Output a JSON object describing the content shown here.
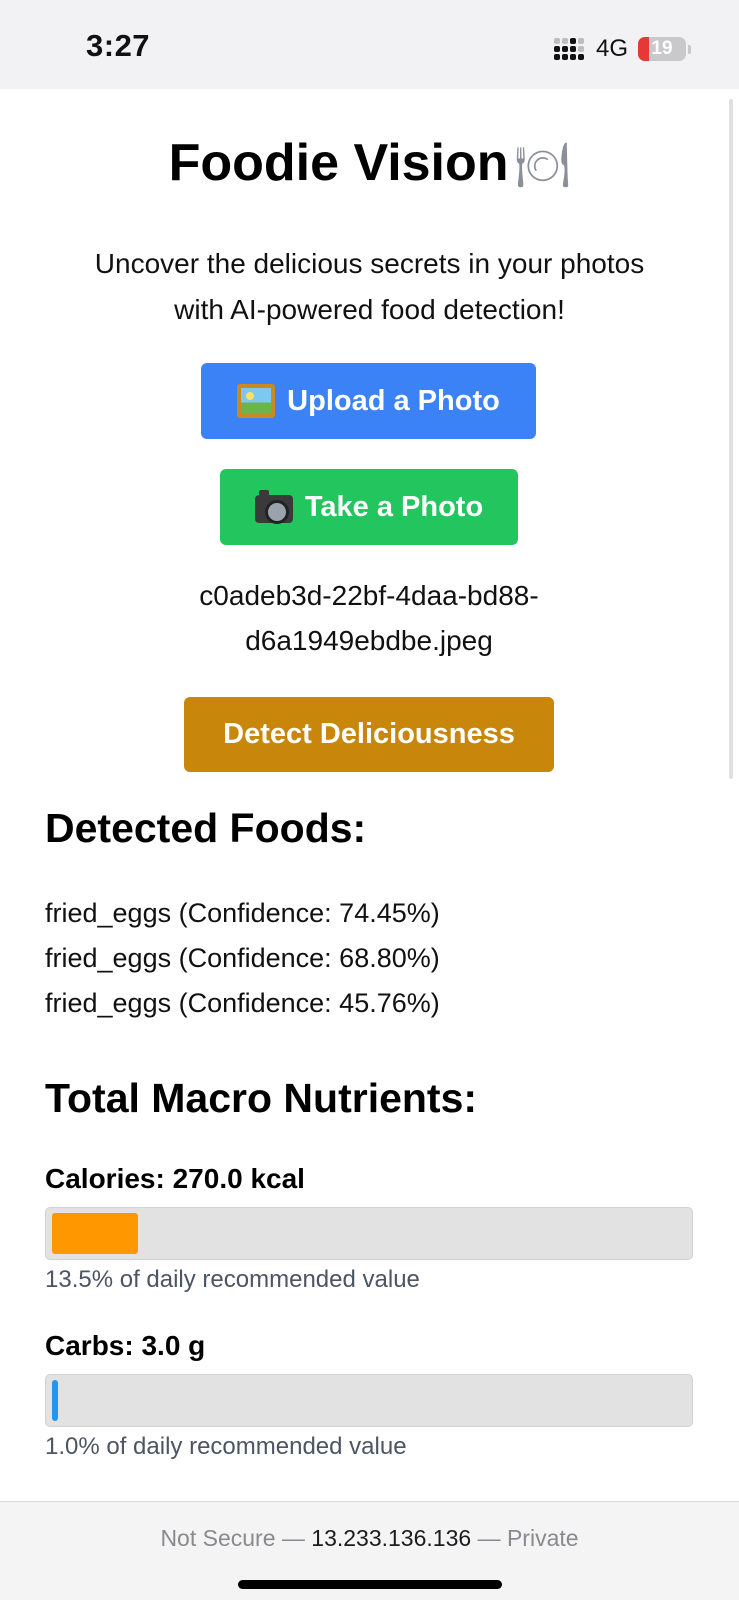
{
  "status_bar": {
    "time": "3:27",
    "network": "4G",
    "battery_level": "19",
    "battery_color": "#e53935"
  },
  "header": {
    "title": "Foodie Vision",
    "title_icon": "fork-and-knife-with-plate-icon",
    "subtitle_line1": "Uncover the delicious secrets in your photos",
    "subtitle_line2": "with AI-powered food detection!"
  },
  "actions": {
    "upload_label": "Upload a Photo",
    "upload_icon": "framed-picture-icon",
    "upload_color": "#3b82f6",
    "camera_label": "Take a Photo",
    "camera_icon": "camera-icon",
    "camera_color": "#22c55e",
    "detect_label": "Detect Deliciousness",
    "detect_color": "#c8860a"
  },
  "selected_file": {
    "line1": "c0adeb3d-22bf-4daa-bd88-",
    "line2": "d6a1949ebdbe.jpeg"
  },
  "detected": {
    "heading": "Detected Foods:",
    "items": [
      "fried_eggs (Confidence: 74.45%)",
      "fried_eggs (Confidence: 68.80%)",
      "fried_eggs (Confidence: 45.76%)"
    ]
  },
  "macros": {
    "heading": "Total Macro Nutrients:",
    "nutrients": [
      {
        "label": "Calories: 270.0 kcal",
        "percent": 13.5,
        "note": "13.5% of daily recommended value",
        "color": "#ff9800"
      },
      {
        "label": "Carbs: 3.0 g",
        "percent": 1.0,
        "note": "1.0% of daily recommended value",
        "color": "#2196f3"
      }
    ]
  },
  "browser": {
    "security": "Not Secure",
    "host": "13.233.136.136",
    "mode": "Private",
    "separator": "—"
  }
}
